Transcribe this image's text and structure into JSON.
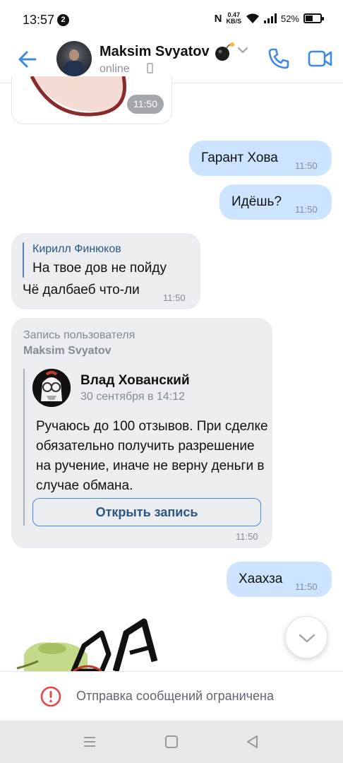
{
  "status_bar": {
    "time": "13:57",
    "notif_count": "2",
    "nfc": "N",
    "speed_value": "0.47",
    "speed_unit": "KB/S",
    "battery": "52%",
    "battery_level": 0.52
  },
  "header": {
    "contact_name": "Maksim Svyatov",
    "status": "online",
    "name_emoji": "bomb"
  },
  "messages": [
    {
      "time": "11:50"
    },
    {
      "text": "Гарант Хова",
      "time": "11:50"
    },
    {
      "text": "Идёшь?",
      "time": "11:50"
    },
    {
      "reply_to": "Кирилл Финюков",
      "reply_text": "На твое дов не пойду",
      "text": "Чё далбаеб что-ли",
      "time": "11:50"
    },
    {
      "post_label": "Запись пользователя",
      "post_author": "Maksim Svyatov",
      "post": {
        "author": "Влад Хованский",
        "date": "30 сентября в 14:12",
        "text": "Ручаюсь до 100 отзывов. При сделке обязательно получить разрешение на ручение, иначе не верну деньги в случае обмана.",
        "button": "Открыть запись"
      },
      "time": "11:50"
    },
    {
      "text": "Хаахза",
      "time": "11:50"
    }
  ],
  "restriction": {
    "text": "Отправка сообщений ограничена"
  },
  "colors": {
    "accent": "#3f8ae0",
    "incoming_bubble": "#ebedf0",
    "outgoing_bubble": "#cce4ff",
    "warning": "#e64646"
  }
}
